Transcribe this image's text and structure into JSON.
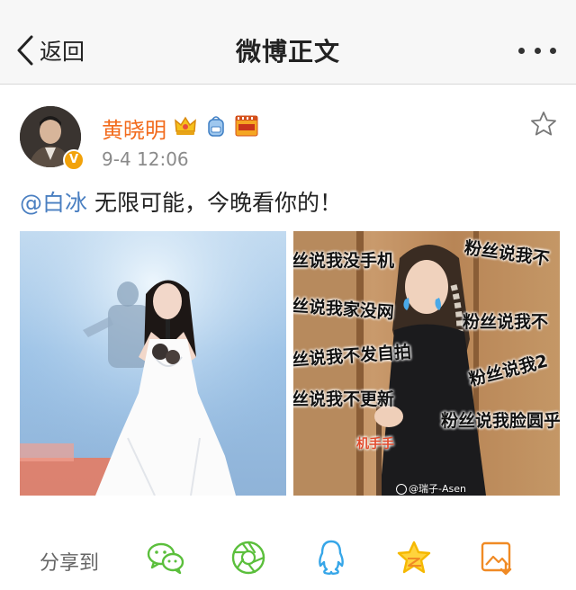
{
  "navbar": {
    "back_label": "返回",
    "title": "微博正文"
  },
  "post": {
    "username": "黄晓明",
    "verified_badge": "V",
    "timestamp": "9-4 12:06",
    "mention": "@白冰",
    "text": " 无限可能，今晚看你的！"
  },
  "images": [
    {
      "name": "photo-singer-stage",
      "caption_partial": ""
    },
    {
      "name": "photo-meme",
      "overlay_lines": [
        "丝说我没手机",
        "粉丝说我不",
        "丝说我家没网",
        "粉丝说我不",
        "丝说我不发自拍",
        "粉丝说我2",
        "丝说我不更新",
        "粉丝说我脸圆乎"
      ],
      "small_label": "机手手",
      "watermark": "@瑞子-Asen"
    }
  ],
  "share": {
    "label": "分享到",
    "targets": [
      "wechat-icon",
      "moments-icon",
      "qq-icon",
      "qzone-icon",
      "image-save-icon"
    ]
  },
  "colors": {
    "username": "#f26b1d",
    "mention": "#4a7fc1",
    "wechat": "#5bbf3c",
    "qq": "#36a6e8",
    "qzone": "#f5b800",
    "save": "#f08a24"
  }
}
